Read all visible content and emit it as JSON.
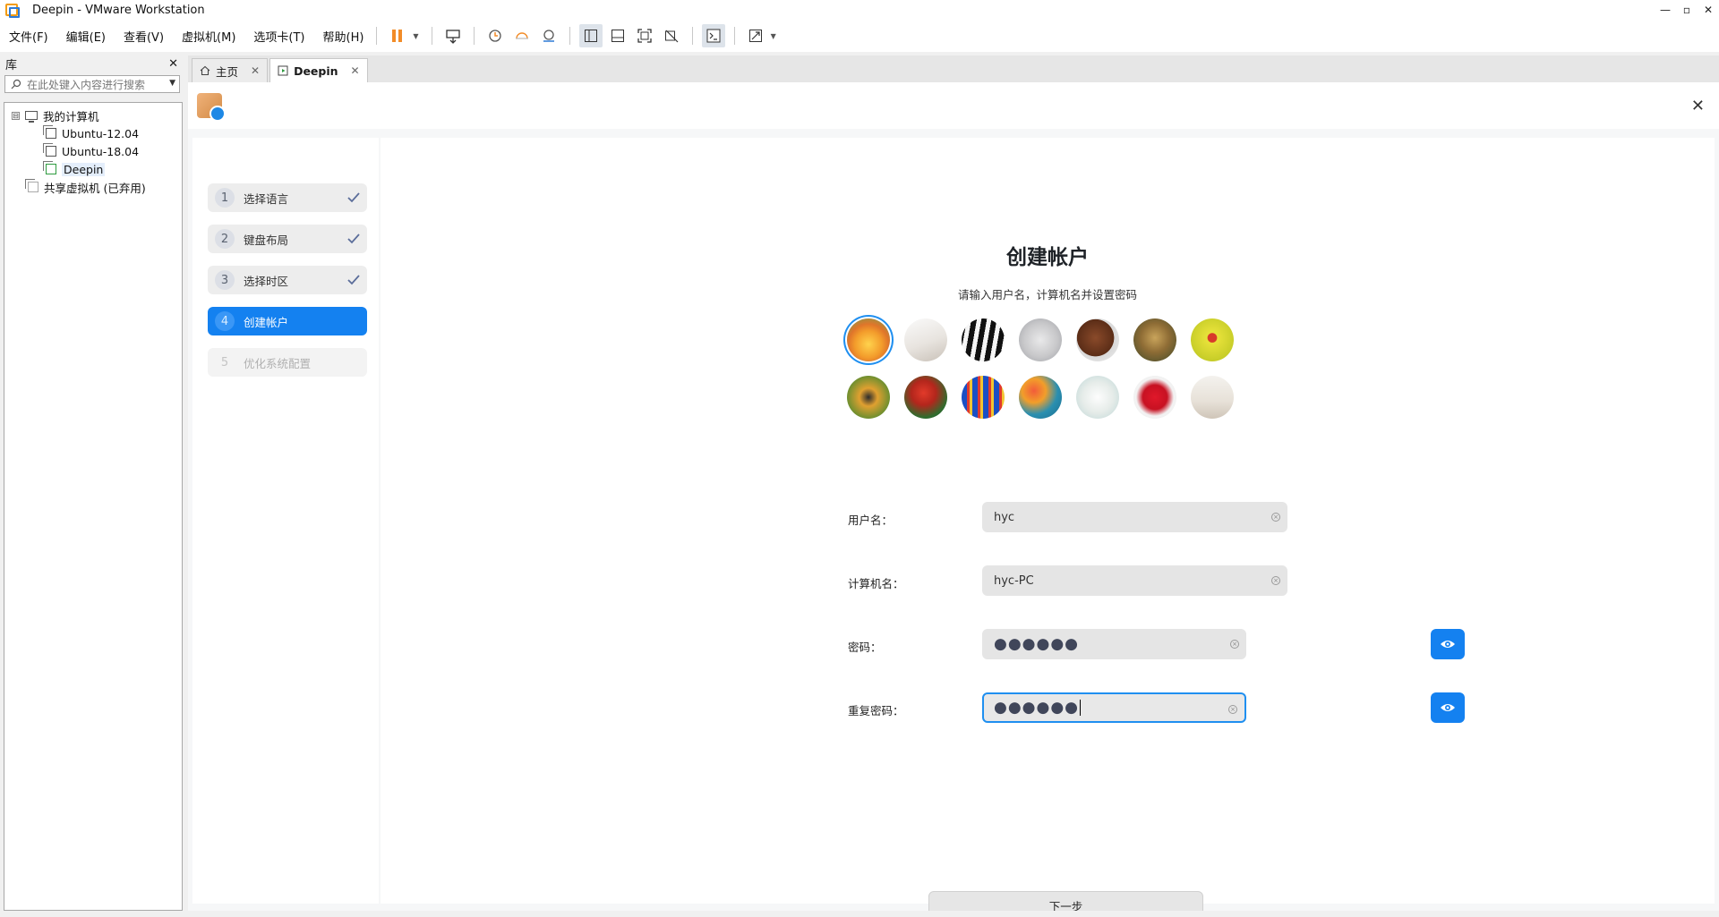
{
  "window": {
    "title": "Deepin - VMware Workstation",
    "controls": [
      "—",
      "▫",
      "✕"
    ]
  },
  "menu": {
    "items": [
      "文件(F)",
      "编辑(E)",
      "查看(V)",
      "虚拟机(M)",
      "选项卡(T)",
      "帮助(H)"
    ]
  },
  "toolbar": {
    "icons": [
      "pause-icon",
      "send-ctrl-alt-del-icon",
      "snapshot-icon",
      "revert-snapshot-icon",
      "snapshot-manager-icon",
      "library-view-icon",
      "thumbnail-bar-icon",
      "fullscreen-icon",
      "unity-icon",
      "console-icon",
      "stretch-icon"
    ],
    "accent": "#f28c28"
  },
  "library": {
    "title": "库",
    "close": "✕",
    "search_placeholder": "在此处键入内容进行搜索",
    "tree": {
      "root": "我的计算机",
      "root_expander": "⊟",
      "vms": [
        "Ubuntu-12.04",
        "Ubuntu-18.04",
        "Deepin"
      ],
      "shared": "共享虚拟机 (已弃用)"
    }
  },
  "tabs": [
    {
      "label": "主页",
      "close": "✕"
    },
    {
      "label": "Deepin",
      "close": "✕"
    }
  ],
  "installer": {
    "close": "✕",
    "steps": [
      {
        "num": "1",
        "label": "选择语言",
        "state": "done"
      },
      {
        "num": "2",
        "label": "键盘布局",
        "state": "done"
      },
      {
        "num": "3",
        "label": "选择时区",
        "state": "done"
      },
      {
        "num": "4",
        "label": "创建帐户",
        "state": "current"
      },
      {
        "num": "5",
        "label": "优化系统配置",
        "state": "future"
      }
    ],
    "title": "创建帐户",
    "subtitle": "请输入用户名，计算机名并设置密码",
    "avatars": [
      "flower",
      "paper",
      "piano",
      "cat",
      "horse",
      "leopard",
      "ladybug",
      "butterfly",
      "parrot",
      "balloon",
      "balloons",
      "ribbon",
      "heart",
      "room"
    ],
    "form": {
      "username_label": "用户名：",
      "username_value": "hyc",
      "hostname_label": "计算机名：",
      "hostname_value": "hyc-PC",
      "password_label": "密码：",
      "password_value": "●●●●●●",
      "repeat_label": "重复密码：",
      "repeat_value": "●●●●●●"
    },
    "next_button": "下一步",
    "accent_color": "#1481f0"
  }
}
